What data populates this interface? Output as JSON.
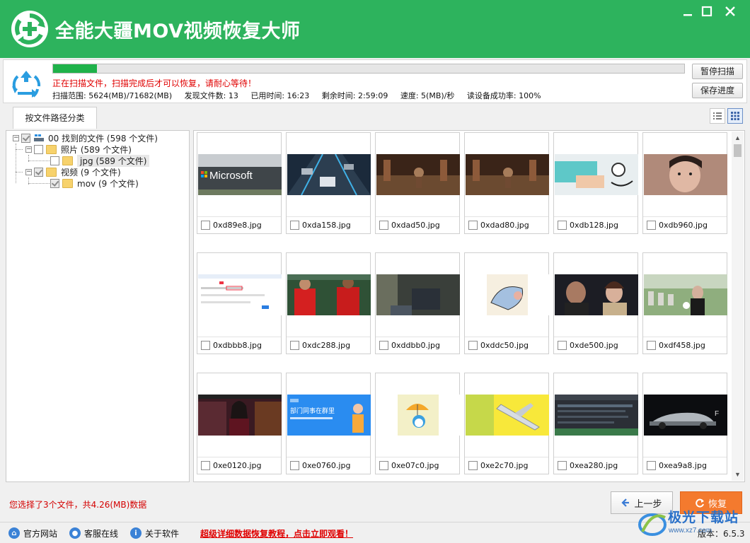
{
  "app": {
    "title": "全能大疆MOV视频恢复大师"
  },
  "scan": {
    "progress": 0.07,
    "message": "正在扫描文件，扫描完成后才可以恢复，请耐心等待！",
    "stats": {
      "range": "扫描范围: 5624(MB)/71682(MB)",
      "found": "发现文件数: 13",
      "elapsed": "已用时间: 16:23",
      "remaining": "剩余时间: 2:59:09",
      "speed": "速度: 5(MB)/秒",
      "success_rate": "读设备成功率: 100%"
    },
    "pause_label": "暂停扫描",
    "save_label": "保存进度"
  },
  "tabs": {
    "active": "按文件路径分类"
  },
  "tree": {
    "root": "00 找到的文件  (598 个文件)",
    "photos": "照片     (589 个文件)",
    "jpg": "jpg     (589 个文件)",
    "videos": "视频     (9 个文件)",
    "mov": "mov     (9 个文件)"
  },
  "files": [
    {
      "name": "0xd89e8.jpg",
      "thumb": "microsoft-sign"
    },
    {
      "name": "0xda158.jpg",
      "thumb": "racing-cars"
    },
    {
      "name": "0xdad50.jpg",
      "thumb": "temple-scene"
    },
    {
      "name": "0xdad80.jpg",
      "thumb": "temple-scene"
    },
    {
      "name": "0xdb128.jpg",
      "thumb": "blood-pressure"
    },
    {
      "name": "0xdb960.jpg",
      "thumb": "woman-portrait"
    },
    {
      "name": "0xdbbb8.jpg",
      "thumb": "software-screenshot"
    },
    {
      "name": "0xdc288.jpg",
      "thumb": "football-players"
    },
    {
      "name": "0xddbb0.jpg",
      "thumb": "dark-room"
    },
    {
      "name": "0xddc50.jpg",
      "thumb": "cartoon-sketch"
    },
    {
      "name": "0xde500.jpg",
      "thumb": "drama-scene"
    },
    {
      "name": "0xdf458.jpg",
      "thumb": "cemetery-scene"
    },
    {
      "name": "0xe0120.jpg",
      "thumb": "news-anchor"
    },
    {
      "name": "0xe0760.jpg",
      "thumb": "group-banner"
    },
    {
      "name": "0xe07c0.jpg",
      "thumb": "doraemon-umbrella"
    },
    {
      "name": "0xe2c70.jpg",
      "thumb": "airplane-yellow"
    },
    {
      "name": "0xea280.jpg",
      "thumb": "python-menu"
    },
    {
      "name": "0xea9a8.jpg",
      "thumb": "car-showroom"
    }
  ],
  "bottom": {
    "selection_info": "您选择了3个文件，共4.26(MB)数据",
    "prev_label": "上一步",
    "recover_label": "恢复"
  },
  "footer": {
    "website": "官方网站",
    "support": "客服在线",
    "about": "关于软件",
    "promo": "超级详细数据恢复教程，点击立即观看！",
    "version": "版本：6.5.3"
  },
  "watermark": {
    "name": "极光下载站",
    "url": "www.xz7.com"
  },
  "colors": {
    "brand_green": "#2db35d",
    "progress": "#1fb24a",
    "alert_red": "#e00000",
    "recover_orange": "#f47a2e"
  }
}
